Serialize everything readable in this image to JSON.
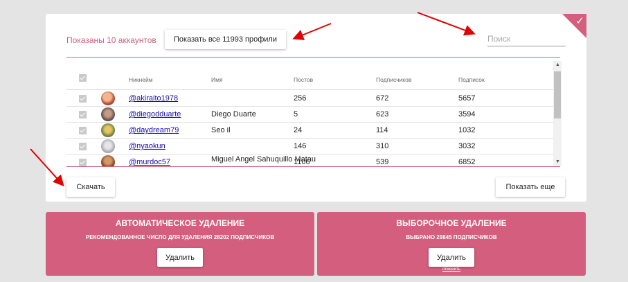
{
  "header": {
    "shown_label": "Показаны 10 аккаунтов",
    "show_all_label": "Показать все 11993 профили",
    "search_placeholder": "Поиск"
  },
  "table": {
    "columns": [
      "Никнейм",
      "Имя",
      "Постов",
      "Подписчиков",
      "Подписок"
    ],
    "rows": [
      {
        "nickname": "@akiraito1978",
        "name": "",
        "posts": "256",
        "followers": "672",
        "following": "5657"
      },
      {
        "nickname": "@diegodduarte",
        "name": "Diego Duarte",
        "posts": "5",
        "followers": "623",
        "following": "3594"
      },
      {
        "nickname": "@daydream79",
        "name": "Seo il",
        "posts": "24",
        "followers": "114",
        "following": "1032"
      },
      {
        "nickname": "@nyaokun",
        "name": "",
        "posts": "146",
        "followers": "310",
        "following": "3032"
      },
      {
        "nickname": "@murdoc57",
        "name": "Miguel Angel Sahuquillo Matau",
        "posts": "1106",
        "followers": "539",
        "following": "6852"
      }
    ]
  },
  "footer": {
    "download_label": "Скачать",
    "more_label": "Показать еще"
  },
  "auto_panel": {
    "title": "АВТОМАТИЧЕСКОЕ УДАЛЕНИЕ",
    "subtitle": "РЕКОМЕНДОВАННОЕ ЧИСЛО ДЛЯ УДАЛЕНИЯ 28202 ПОДПИСЧИКОВ",
    "button_label": "Удалить"
  },
  "select_panel": {
    "title": "ВЫБОРОЧНОЕ УДАЛЕНИЕ",
    "subtitle": "ВЫБРАНО 29845 ПОДПИСЧИКОВ",
    "button_label": "Удалить",
    "cancel_label": "отменить"
  },
  "icons": {
    "corner": "check-icon",
    "checkbox": "checkbox-checked-icon",
    "scroll_up": "arrow-up-icon",
    "scroll_down": "arrow-down-icon",
    "annotation": "red-arrow-icon"
  },
  "colors": {
    "accent": "#d35e7e",
    "annotation": "#e00000",
    "link": "#1a0dab"
  }
}
